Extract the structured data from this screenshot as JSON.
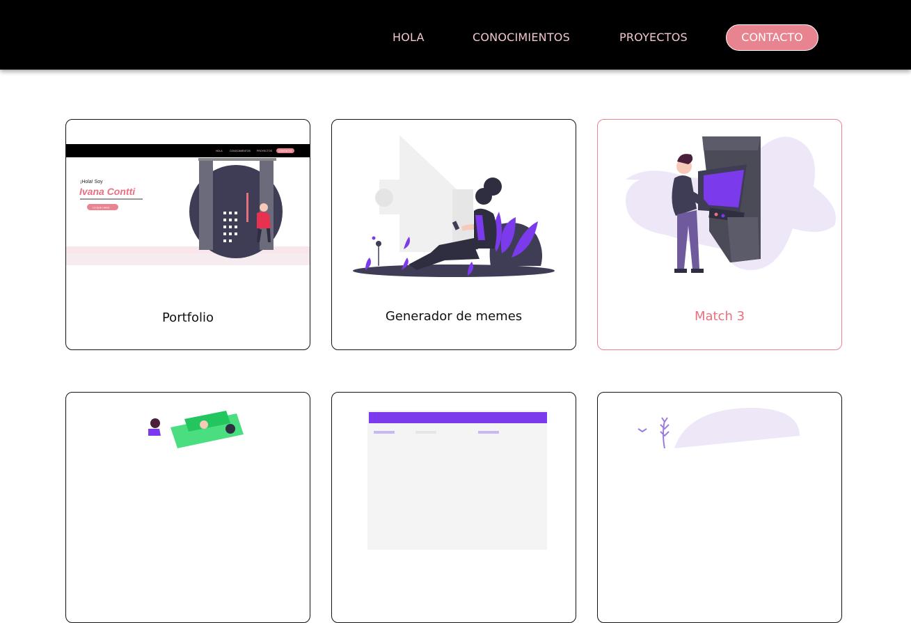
{
  "nav": {
    "items": [
      {
        "label": "HOLA"
      },
      {
        "label": "CONOCIMIENTOS"
      },
      {
        "label": "PROYECTOS"
      }
    ],
    "cta_label": "CONTACTO"
  },
  "projects": [
    {
      "title": "Portfolio",
      "thumb": {
        "mini_nav": [
          "HOLA",
          "CONOCIMIENTOS",
          "PROYECTOS"
        ],
        "mini_cta": "CONTACTO",
        "greeting": "¡Hola! Soy",
        "name": "Ivana Contti",
        "button": "LO QUE HAGO"
      }
    },
    {
      "title": "Generador de memes"
    },
    {
      "title": "Match 3"
    },
    {
      "title": ""
    },
    {
      "title": ""
    },
    {
      "title": ""
    }
  ],
  "colors": {
    "topbar": "#000000",
    "nav_text": "#f3c7cf",
    "accent": "#e8848f",
    "purple": "#7c3aed",
    "dark": "#3f3d56"
  }
}
